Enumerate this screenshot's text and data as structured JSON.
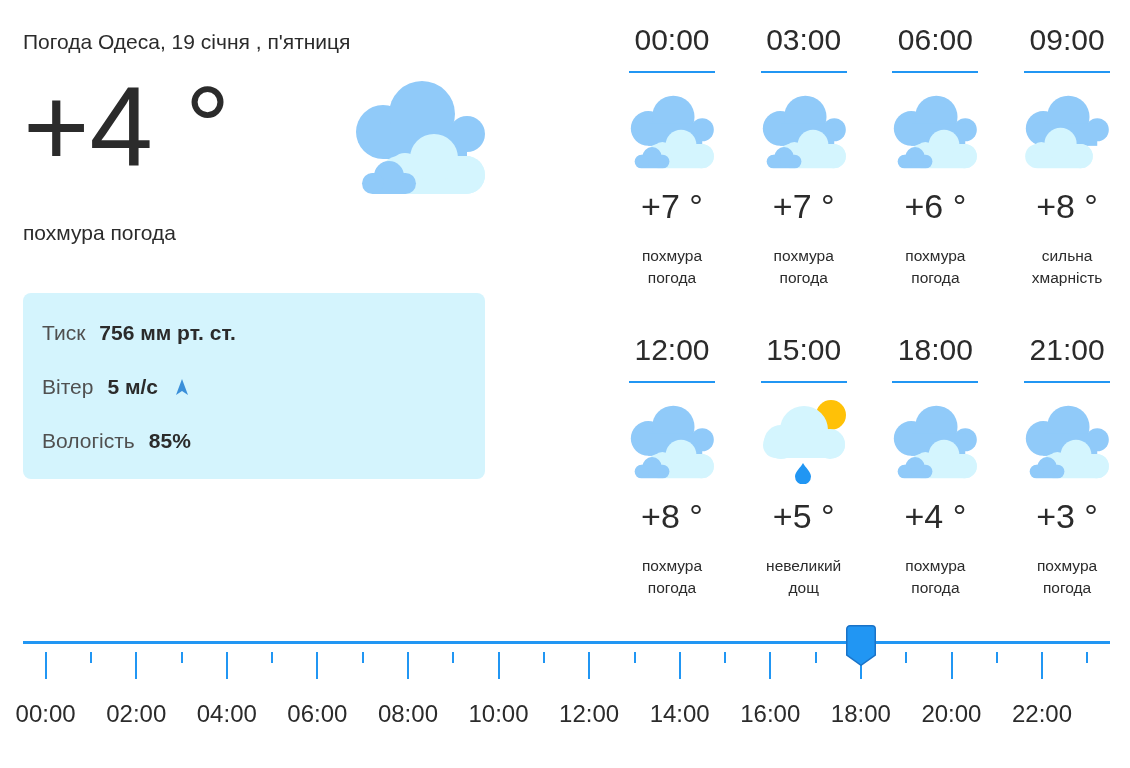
{
  "current": {
    "title": "Погода Одеса, 19 січня , п'ятниця",
    "temperature": "+4 °",
    "description": "похмура погода"
  },
  "details": [
    {
      "kind": "plain",
      "label": "Тиск",
      "value": "756 мм рт. ст."
    },
    {
      "kind": "wind",
      "label": "Вітер",
      "value": "5 м/с"
    },
    {
      "kind": "plain",
      "label": "Вологість",
      "value": "85%"
    }
  ],
  "forecast": [
    {
      "time": "00:00",
      "kind": "overcast",
      "temperature": "+7 °",
      "description": "похмура погода"
    },
    {
      "time": "03:00",
      "kind": "overcast",
      "temperature": "+7 °",
      "description": "похмура погода"
    },
    {
      "time": "06:00",
      "kind": "overcast",
      "temperature": "+6 °",
      "description": "похмура погода"
    },
    {
      "time": "09:00",
      "kind": "cloudy",
      "temperature": "+8 °",
      "description": "сильна хмарність"
    },
    {
      "time": "12:00",
      "kind": "overcast",
      "temperature": "+8 °",
      "description": "похмура погода"
    },
    {
      "time": "15:00",
      "kind": "rain",
      "temperature": "+5 °",
      "description": "невеликий дощ"
    },
    {
      "time": "18:00",
      "kind": "overcast",
      "temperature": "+4 °",
      "description": "похмура погода"
    },
    {
      "time": "21:00",
      "kind": "overcast",
      "temperature": "+3 °",
      "description": "похмура погода"
    }
  ],
  "timeline": {
    "level": 0.771,
    "labels": [
      "00:00",
      "02:00",
      "04:00",
      "06:00",
      "08:00",
      "10:00",
      "12:00",
      "14:00",
      "16:00",
      "18:00",
      "20:00",
      "22:00"
    ]
  }
}
